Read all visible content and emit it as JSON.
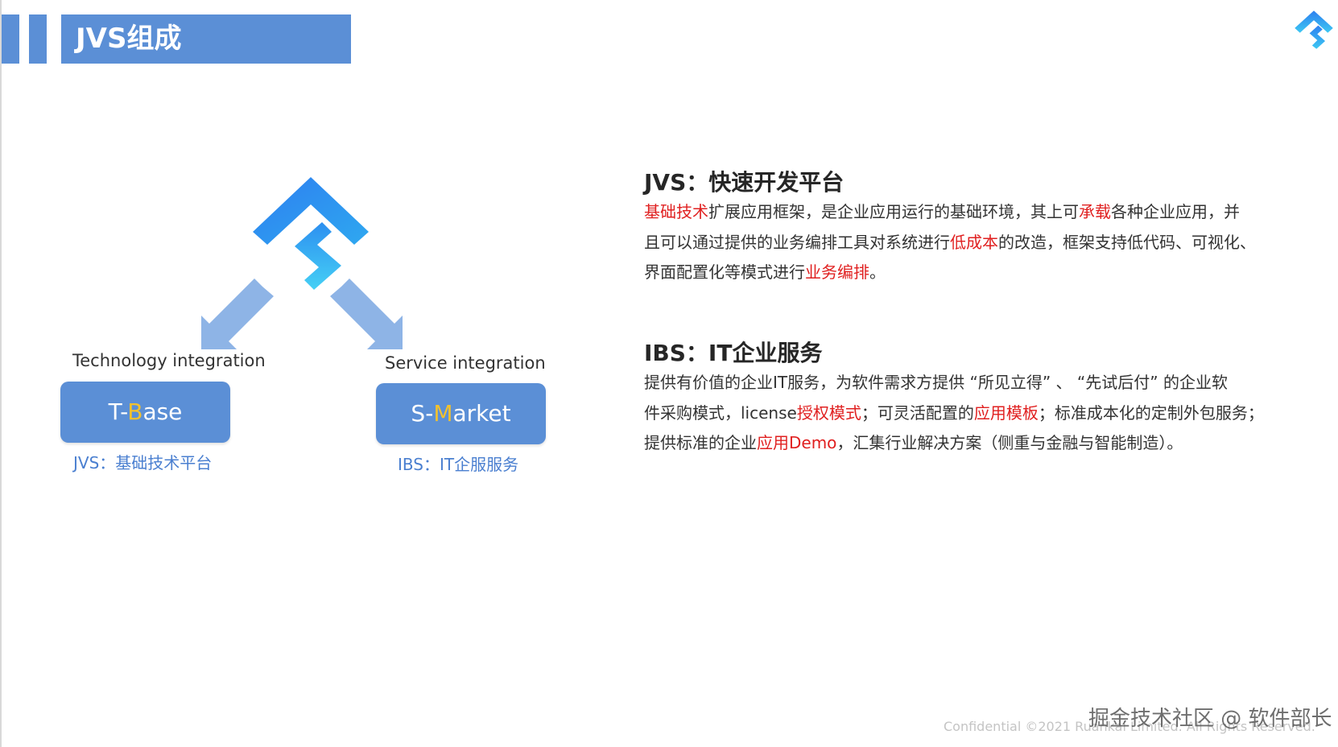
{
  "header": {
    "title": "JVS组成"
  },
  "logo_icon": "jvs-s-diamond-logo",
  "colors": {
    "header_blue": "#5b8fd6",
    "logo_gradient_start": "#2d7ff0",
    "logo_gradient_end": "#3dc8f2",
    "arrow_blue": "#8eb4e6",
    "highlight_red": "#e02020",
    "accent_yellow": "#f2c12e",
    "sub_label_blue": "#4a7fd0"
  },
  "diagram": {
    "left_caption": "Technology integration",
    "right_caption": "Service integration",
    "left_box": {
      "prefix": "T-",
      "accent": "B",
      "rest": "ase"
    },
    "right_box": {
      "prefix": "S-",
      "accent": "M",
      "rest": "arket"
    },
    "left_sub": "JVS：基础技术平台",
    "right_sub": "IBS：IT企服服务"
  },
  "section1": {
    "title": "JVS：快速开发平台",
    "lines": [
      [
        {
          "t": "基础技术",
          "hl": true
        },
        {
          "t": "扩展应用框架，是企业应用运行的基础环境，其上可"
        },
        {
          "t": "承载",
          "hl": true
        },
        {
          "t": "各种企业应用，并"
        }
      ],
      [
        {
          "t": "且可以通过提供的业务编排工具对系统进行"
        },
        {
          "t": "低成本",
          "hl": true
        },
        {
          "t": "的改造，框架支持低代码、可视化、"
        }
      ],
      [
        {
          "t": "界面配置化等模式进行"
        },
        {
          "t": "业务编排",
          "hl": true
        },
        {
          "t": "。"
        }
      ]
    ]
  },
  "section2": {
    "title": "IBS：IT企业服务",
    "lines": [
      [
        {
          "t": "提供有价值的企业IT服务，为软件需求方提供 “所见立得” 、 “先试后付” 的企业软"
        }
      ],
      [
        {
          "t": "件采购模式，license"
        },
        {
          "t": "授权模式",
          "hl": true
        },
        {
          "t": "；可灵活配置的"
        },
        {
          "t": "应用模板",
          "hl": true
        },
        {
          "t": "；标准成本化的定制外包服务；"
        }
      ],
      [
        {
          "t": "提供标准的企业"
        },
        {
          "t": "应用Demo",
          "hl": true
        },
        {
          "t": "，汇集行业解决方案（侧重与金融与智能制造）。"
        }
      ]
    ]
  },
  "footer": {
    "confidential": "Confidential ©2021 Ruankai Limited. All Rights Reserved.",
    "watermark": "掘金技术社区 @ 软件部长"
  }
}
